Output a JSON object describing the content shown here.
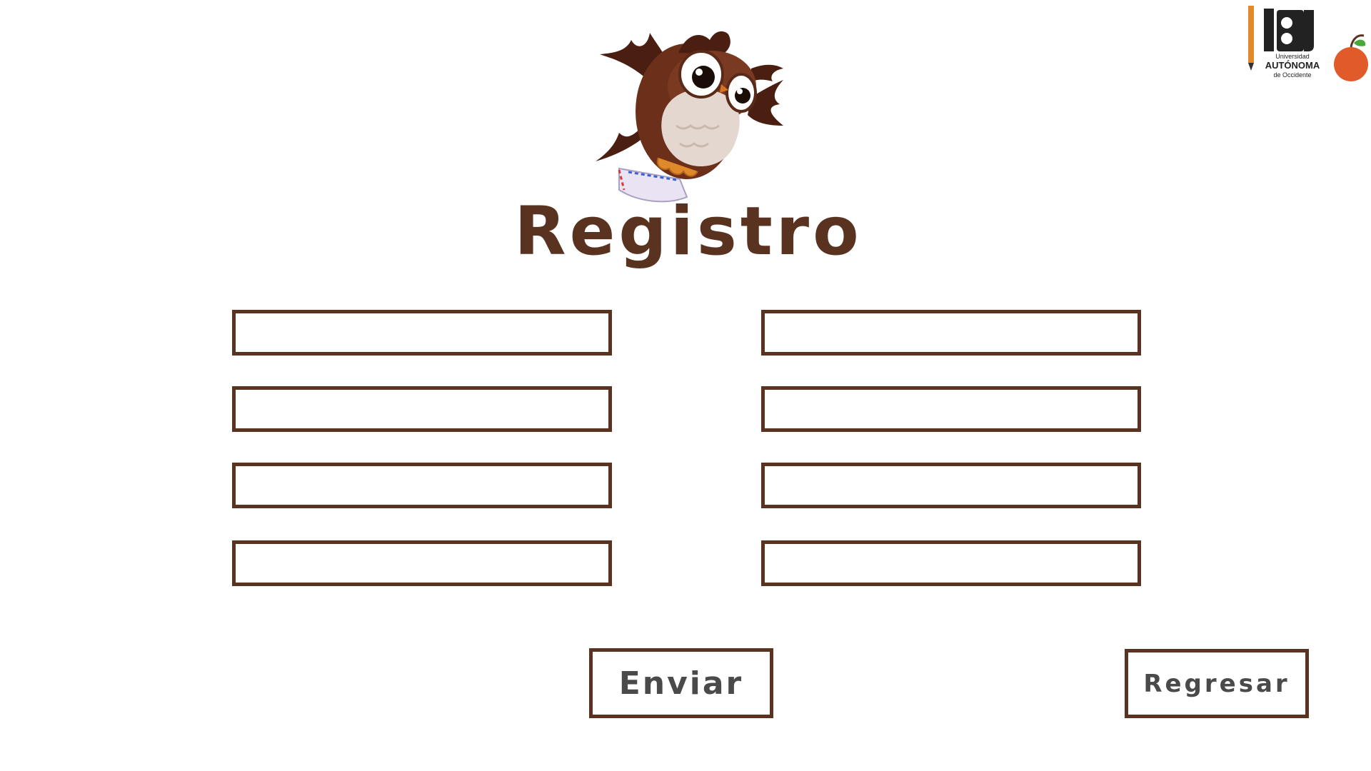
{
  "page": {
    "title": "Registro"
  },
  "logo": {
    "line1": "Universidad",
    "line2": "AUTÓNOMA",
    "line3": "de Occidente"
  },
  "form": {
    "fields": [
      {
        "value": "",
        "placeholder": ""
      },
      {
        "value": "",
        "placeholder": ""
      },
      {
        "value": "",
        "placeholder": ""
      },
      {
        "value": "",
        "placeholder": ""
      },
      {
        "value": "",
        "placeholder": ""
      },
      {
        "value": "",
        "placeholder": ""
      },
      {
        "value": "",
        "placeholder": ""
      },
      {
        "value": "",
        "placeholder": ""
      }
    ]
  },
  "buttons": {
    "submit_label": "Enviar",
    "back_label": "Regresar"
  },
  "colors": {
    "border": "#5a3320",
    "title": "#5a3320",
    "button_text": "#4a4a4a",
    "background": "#ffffff"
  }
}
